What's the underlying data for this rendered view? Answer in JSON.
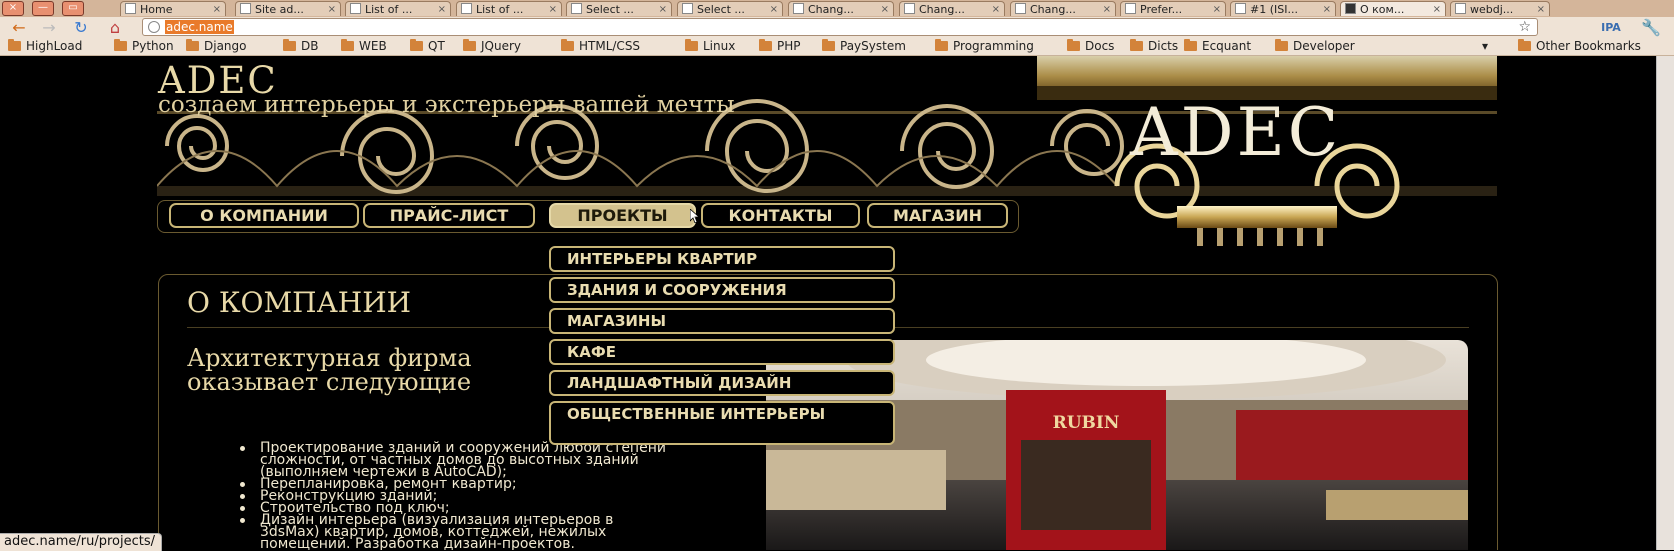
{
  "browser": {
    "window_buttons": [
      "×",
      "—",
      "▭"
    ],
    "tabs": [
      {
        "title": "Home",
        "active": false
      },
      {
        "title": "Site ad...",
        "active": false
      },
      {
        "title": "List of ...",
        "active": false
      },
      {
        "title": "List of ...",
        "active": false
      },
      {
        "title": "Select ...",
        "active": false
      },
      {
        "title": "Select ...",
        "active": false
      },
      {
        "title": "Chang...",
        "active": false
      },
      {
        "title": "Chang...",
        "active": false
      },
      {
        "title": "Chang...",
        "active": false
      },
      {
        "title": "Prefer...",
        "active": false
      },
      {
        "title": "#1 (ISI...",
        "active": false
      },
      {
        "title": "О ком...",
        "active": true
      },
      {
        "title": "webdj...",
        "active": false
      }
    ],
    "url": "adec.name",
    "bookmarks": [
      "HighLoad",
      "Python",
      "Django",
      "DB",
      "WEB",
      "QT",
      "JQuery",
      "HTML/CSS",
      "Linux",
      "PHP",
      "PaySystem",
      "Programming",
      "Docs",
      "Dicts",
      "Ecquant",
      "Developer"
    ],
    "other_bookmarks": "Other Bookmarks",
    "status_url": "adec.name/ru/projects/"
  },
  "site": {
    "title": "ADEC",
    "tagline": "создаем интерьеры и экстерьеры вашей мечты",
    "logo": "ADEC",
    "menu": [
      "О КОМПАНИИ",
      "ПРАЙС-ЛИСТ",
      "ПРОЕКТЫ",
      "КОНТАКТЫ",
      "МАГАЗИН"
    ],
    "active_menu": "ПРОЕКТЫ",
    "submenu": [
      "ИНТЕРЬЕРЫ КВАРТИР",
      "ЗДАНИЯ И СООРУЖЕНИЯ",
      "МАГАЗИНЫ",
      "КАФЕ",
      "ЛАНДШАФТНЫЙ ДИЗАЙН",
      "ОБЩЕСТВЕННЫЕ ИНТЕРЬЕРЫ"
    ],
    "heading": "О КОМПАНИИ",
    "intro_line1": "Архитектурная фирма",
    "intro_line2": "оказывает следующие",
    "services": [
      [
        "Проектирование зданий и сооружений любой степени",
        "сложности, от частных домов до высотных зданий",
        "(выполняем чертежи в AutoCAD);"
      ],
      [
        "Перепланировка, ремонт квартир;"
      ],
      [
        "Реконструкцию зданий;"
      ],
      [
        "Строительство под ключ;"
      ],
      [
        "Дизайн интерьера (визуализация интерьеров в",
        "3dsMax) квартир, домов, коттеджей, нежилых",
        "помещений. Разработка дизайн-проектов."
      ]
    ],
    "photo_sign": "RUBIN"
  },
  "colors": {
    "accent": "#d3c28e",
    "gold": "#e8d9a8",
    "background": "#000000",
    "red": "#b01a1e"
  }
}
